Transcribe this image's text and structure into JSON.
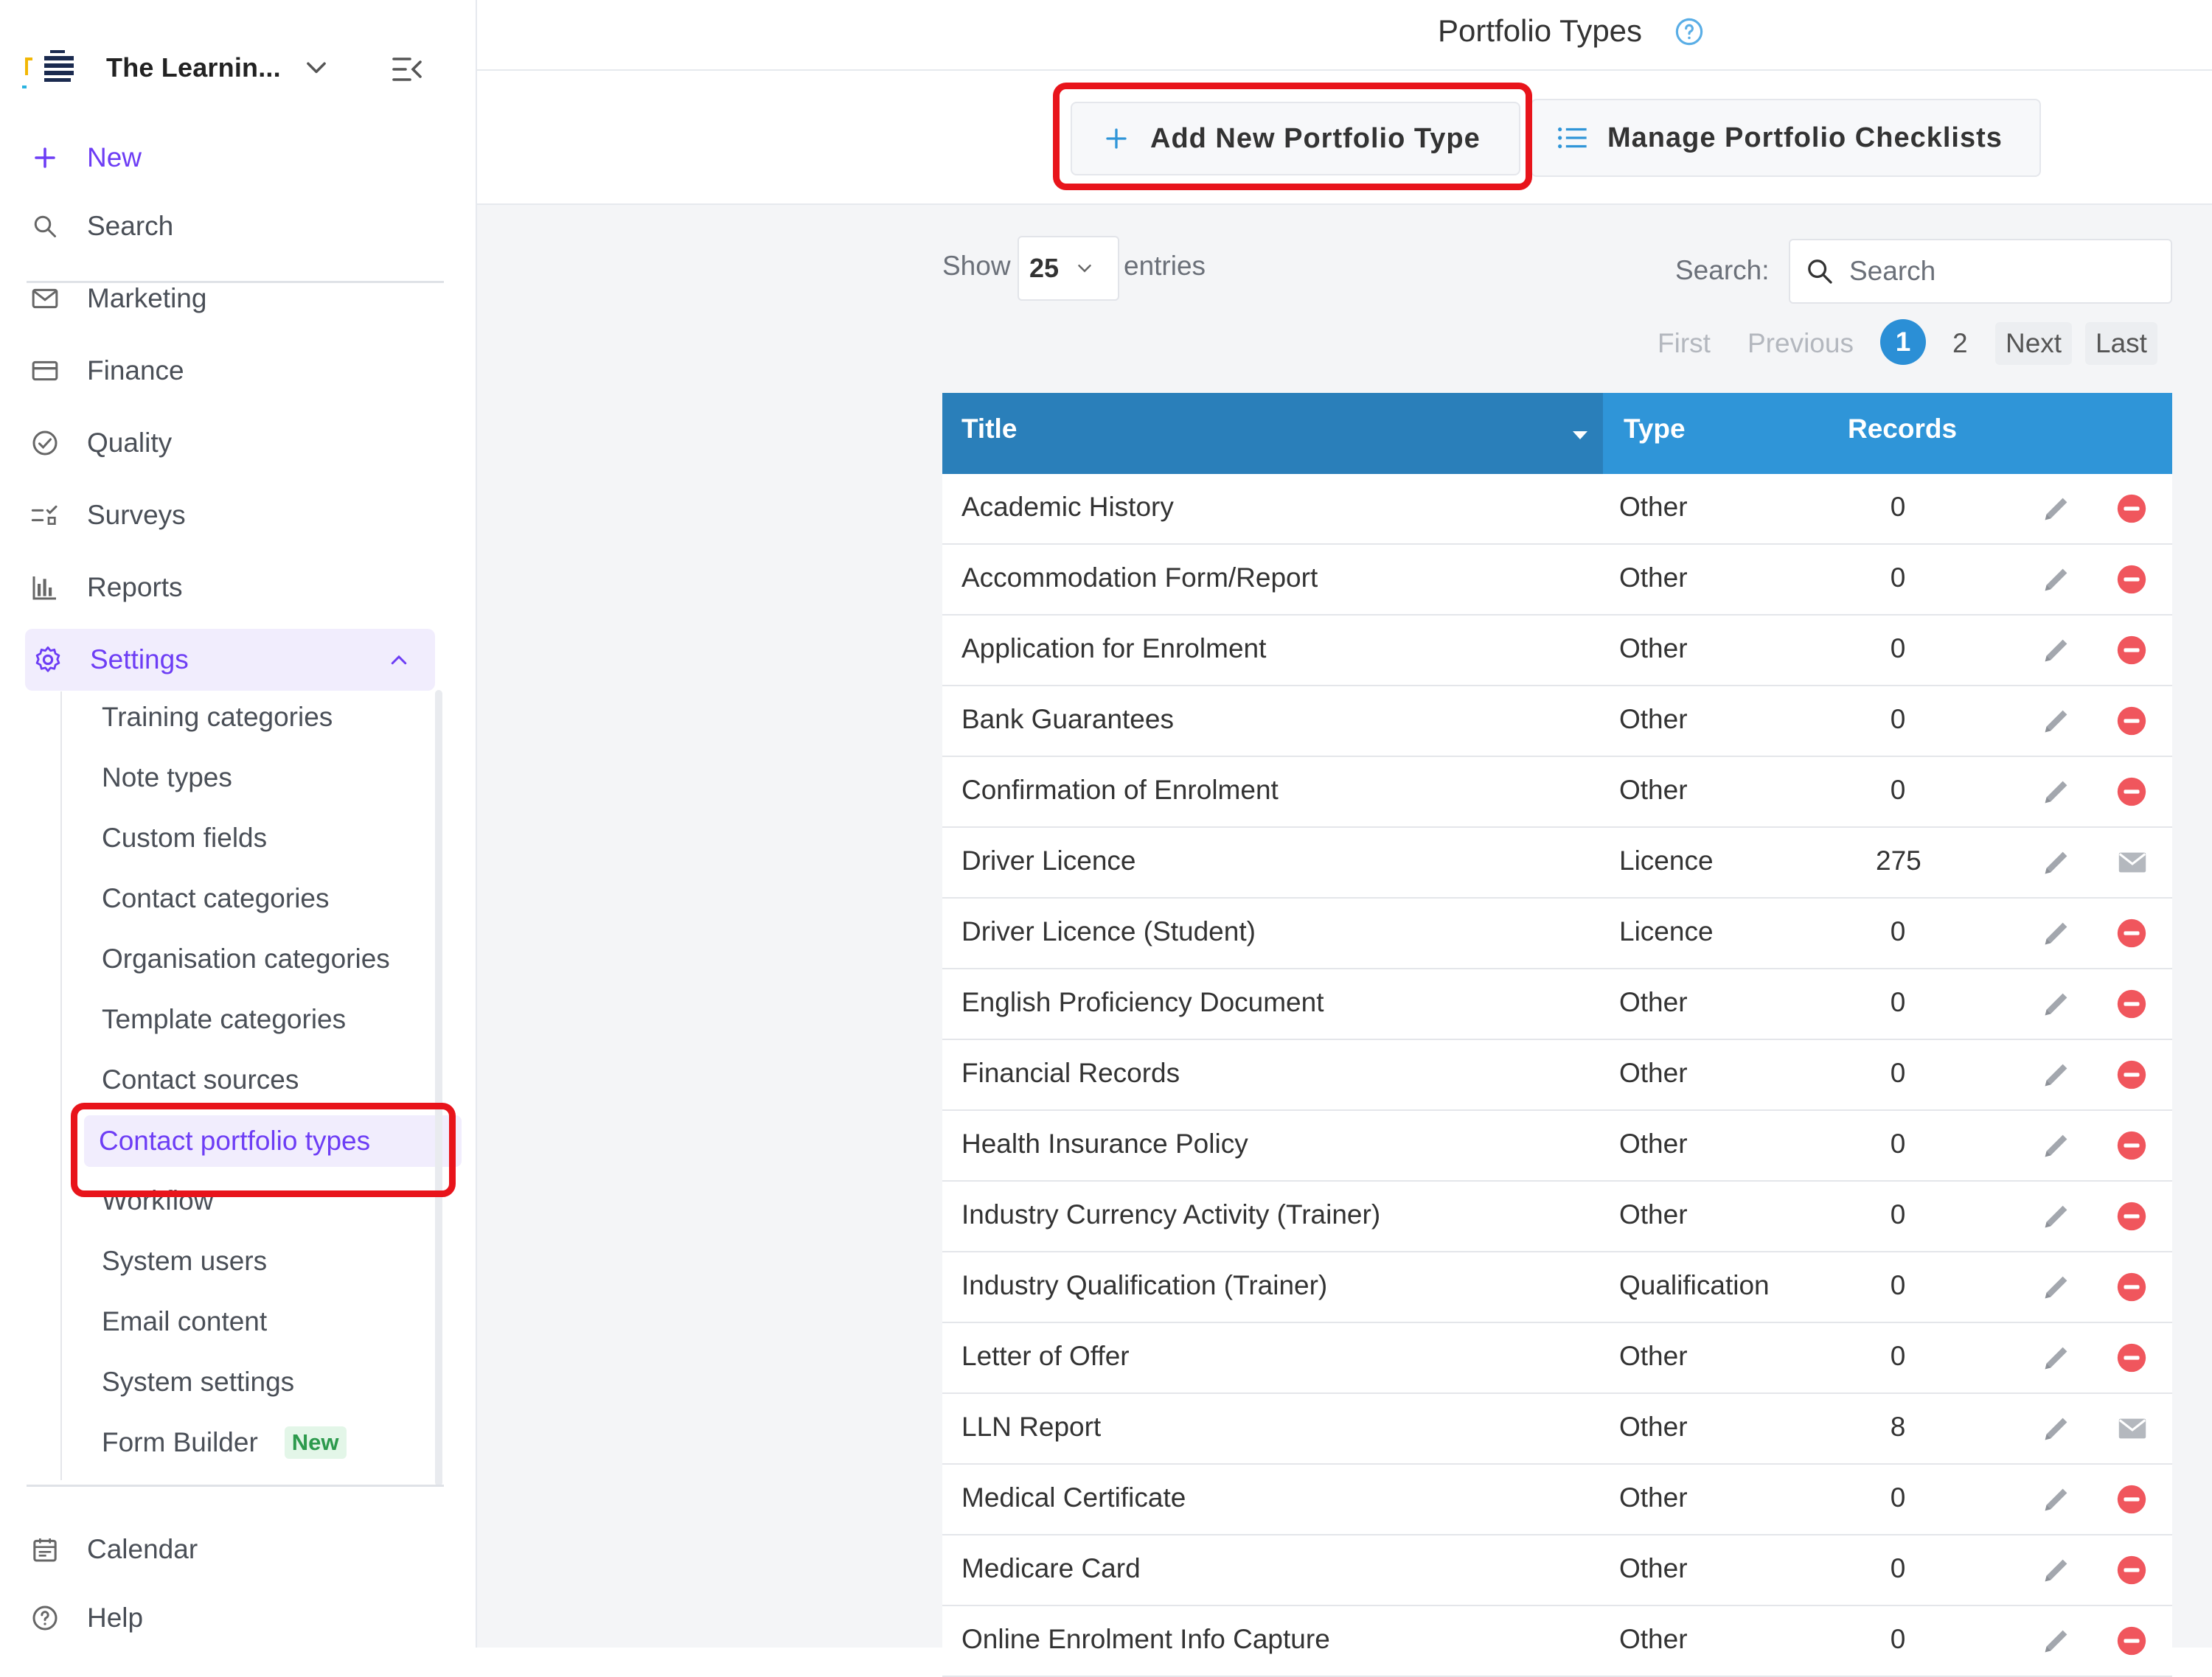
{
  "sidebar": {
    "brand_title": "The Learnin...",
    "nav": {
      "new": "New",
      "search": "Search",
      "marketing": "Marketing",
      "finance": "Finance",
      "quality": "Quality",
      "surveys": "Surveys",
      "reports": "Reports",
      "settings": "Settings"
    },
    "settings_items": [
      "Training categories",
      "Note types",
      "Custom fields",
      "Contact categories",
      "Organisation categories",
      "Template categories",
      "Contact sources",
      "Contact portfolio types",
      "Workflow",
      "System users",
      "Email content",
      "System settings",
      "Form Builder"
    ],
    "form_builder_badge": "New",
    "active_item": "Contact portfolio types",
    "bottom": {
      "calendar": "Calendar",
      "help": "Help"
    }
  },
  "header": {
    "title": "Portfolio Types"
  },
  "toolbar": {
    "add_label": "Add New Portfolio Type",
    "manage_label": "Manage Portfolio Checklists"
  },
  "table_controls": {
    "show_label": "Show",
    "page_size": "25",
    "entries_label": "entries",
    "search_label": "Search:",
    "search_placeholder": "Search"
  },
  "pagination": {
    "first": "First",
    "previous": "Previous",
    "current": "1",
    "page2": "2",
    "next": "Next",
    "last": "Last"
  },
  "table": {
    "columns": [
      "Title",
      "Type",
      "Records"
    ],
    "rows": [
      {
        "title": "Academic History",
        "type": "Other",
        "records": "0",
        "action_icon": "delete-icon"
      },
      {
        "title": "Accommodation Form/Report",
        "type": "Other",
        "records": "0",
        "action_icon": "delete-icon"
      },
      {
        "title": "Application for Enrolment",
        "type": "Other",
        "records": "0",
        "action_icon": "delete-icon"
      },
      {
        "title": "Bank Guarantees",
        "type": "Other",
        "records": "0",
        "action_icon": "delete-icon"
      },
      {
        "title": "Confirmation of Enrolment",
        "type": "Other",
        "records": "0",
        "action_icon": "delete-icon"
      },
      {
        "title": "Driver Licence",
        "type": "Licence",
        "records": "275",
        "action_icon": "envelope-icon"
      },
      {
        "title": "Driver Licence (Student)",
        "type": "Licence",
        "records": "0",
        "action_icon": "delete-icon"
      },
      {
        "title": "English Proficiency Document",
        "type": "Other",
        "records": "0",
        "action_icon": "delete-icon"
      },
      {
        "title": "Financial Records",
        "type": "Other",
        "records": "0",
        "action_icon": "delete-icon"
      },
      {
        "title": "Health Insurance Policy",
        "type": "Other",
        "records": "0",
        "action_icon": "delete-icon"
      },
      {
        "title": "Industry Currency Activity (Trainer)",
        "type": "Other",
        "records": "0",
        "action_icon": "delete-icon"
      },
      {
        "title": "Industry Qualification (Trainer)",
        "type": "Qualification",
        "records": "0",
        "action_icon": "delete-icon"
      },
      {
        "title": "Letter of Offer",
        "type": "Other",
        "records": "0",
        "action_icon": "delete-icon"
      },
      {
        "title": "LLN Report",
        "type": "Other",
        "records": "8",
        "action_icon": "envelope-icon"
      },
      {
        "title": "Medical Certificate",
        "type": "Other",
        "records": "0",
        "action_icon": "delete-icon"
      },
      {
        "title": "Medicare Card",
        "type": "Other",
        "records": "0",
        "action_icon": "delete-icon"
      },
      {
        "title": "Online Enrolment Info Capture",
        "type": "Other",
        "records": "0",
        "action_icon": "delete-icon"
      }
    ]
  },
  "colors": {
    "accent_purple": "#6d3df5",
    "header_blue": "#2f95d8",
    "header_blue_dark": "#2a7fba",
    "highlight_red": "#e8141b",
    "delete_red": "#f0565d"
  }
}
